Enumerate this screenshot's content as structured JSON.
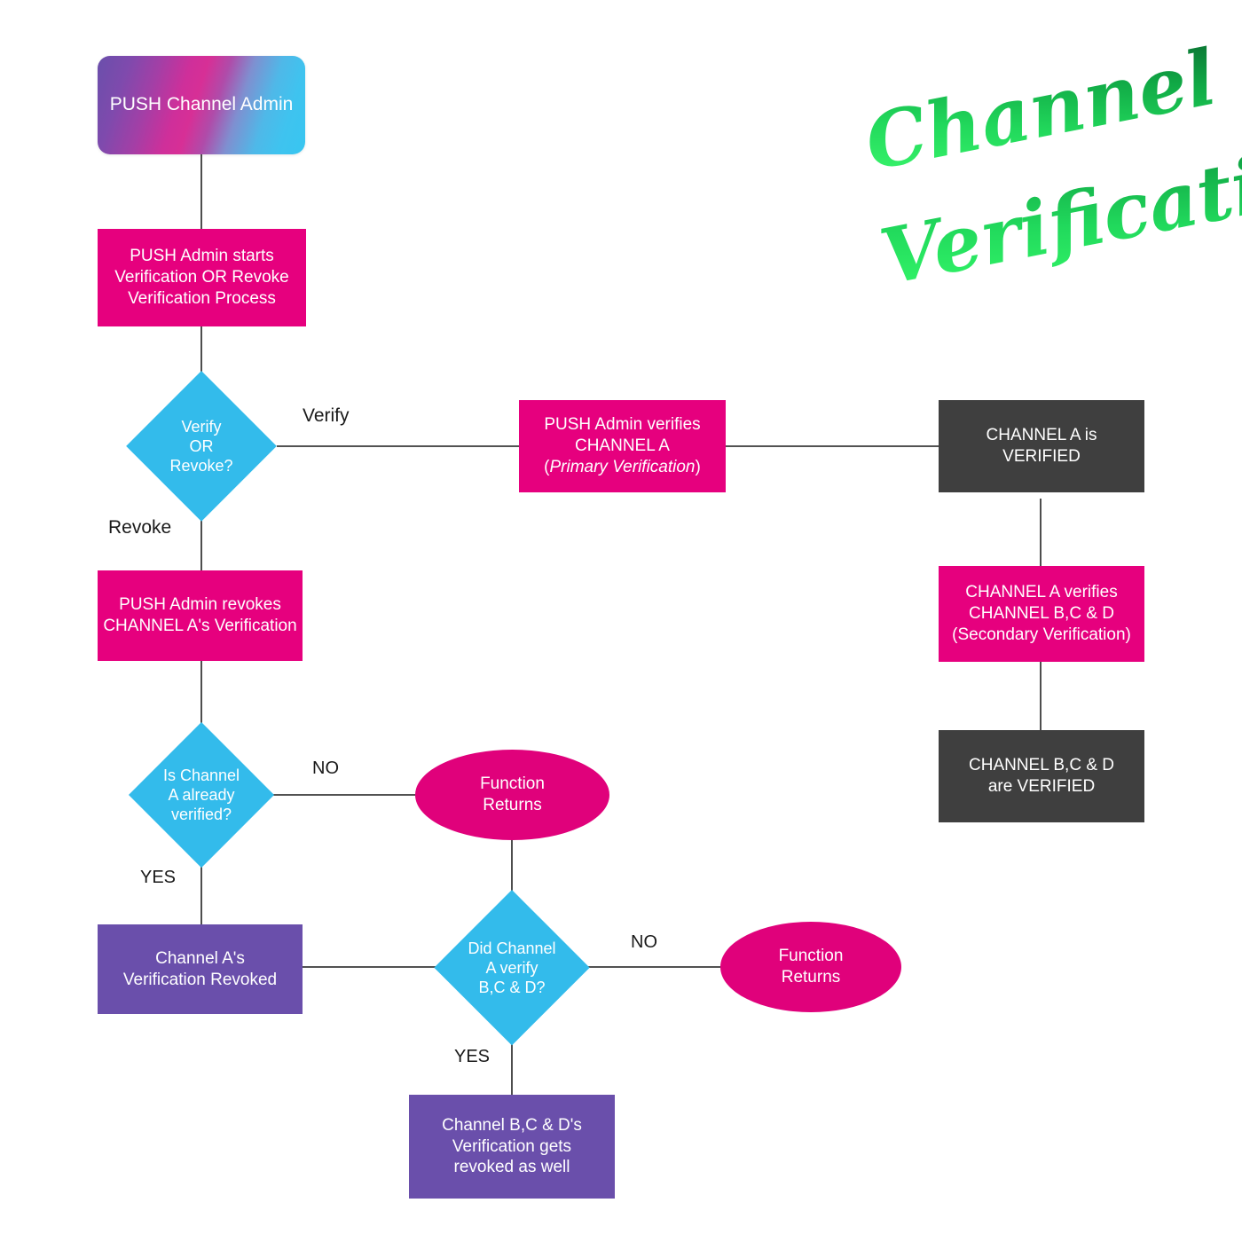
{
  "title": {
    "line1": "Channel",
    "line2": "Verification",
    "color_light": "#2ee86a",
    "color_dark": "#0f7a3a"
  },
  "colors": {
    "pink": "#e6007e",
    "cyan": "#33bbeb",
    "dark": "#3f3f3f",
    "purple": "#6a4fab",
    "ellipse_pink": "#e0017b",
    "connector": "#3a3a3a",
    "background": "#ffffff",
    "gradient_start": "#6a4fab",
    "gradient_mid": "#d72f96",
    "gradient_end": "#38c6f0"
  },
  "nodes": {
    "start": {
      "label": "PUSH Channel Admin",
      "shape": "rounded-rect",
      "color": "gradient"
    },
    "admin_starts": {
      "label": "PUSH Admin starts\nVerification OR Revoke\nVerification Process",
      "shape": "rect",
      "color": "pink"
    },
    "verify_or_revoke": {
      "label": "Verify\nOR\nRevoke?",
      "shape": "diamond",
      "color": "cyan"
    },
    "admin_verifies": {
      "label_line1": "PUSH Admin verifies",
      "label_line2": "CHANNEL A",
      "label_line3_pre": "(",
      "label_line3_italic": "Primary Verification",
      "label_line3_post": ")",
      "shape": "rect",
      "color": "pink"
    },
    "channel_a_verified": {
      "label": "CHANNEL A is\nVERIFIED",
      "shape": "rect",
      "color": "dark"
    },
    "channel_a_verifies_bcd": {
      "label": "CHANNEL A verifies\nCHANNEL B,C & D\n(Secondary Verification)",
      "shape": "rect",
      "color": "pink"
    },
    "channel_bcd_verified": {
      "label": "CHANNEL B,C & D\nare VERIFIED",
      "shape": "rect",
      "color": "dark"
    },
    "admin_revokes": {
      "label": "PUSH Admin revokes\nCHANNEL A's Verification",
      "shape": "rect",
      "color": "pink"
    },
    "is_a_verified": {
      "label": "Is Channel\nA already\nverified?",
      "shape": "diamond",
      "color": "cyan"
    },
    "function_returns_1": {
      "label": "Function\nReturns",
      "shape": "ellipse",
      "color": "pink"
    },
    "a_revoked": {
      "label": "Channel A's\nVerification Revoked",
      "shape": "rect",
      "color": "purple"
    },
    "did_a_verify_bcd": {
      "label": "Did Channel\nA verify\nB,C & D?",
      "shape": "diamond",
      "color": "cyan"
    },
    "function_returns_2": {
      "label": "Function\nReturns",
      "shape": "ellipse",
      "color": "pink"
    },
    "bcd_revoked": {
      "label": "Channel B,C & D's\nVerification gets\nrevoked as well",
      "shape": "rect",
      "color": "purple"
    }
  },
  "edge_labels": {
    "verify": "Verify",
    "revoke": "Revoke",
    "no_1": "NO",
    "yes_1": "YES",
    "no_2": "NO",
    "yes_2": "YES"
  }
}
